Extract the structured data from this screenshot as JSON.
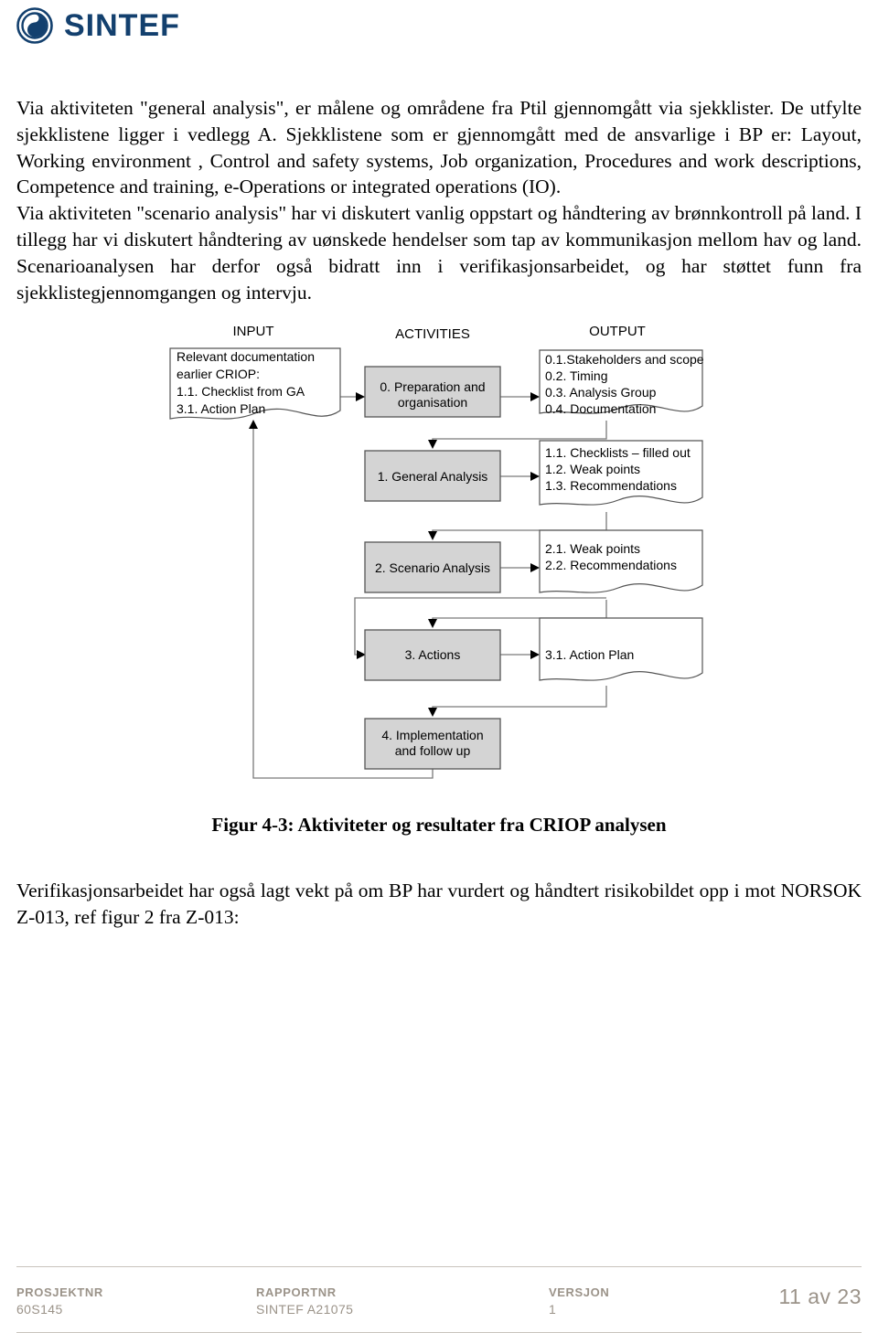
{
  "header": {
    "logo_text": "SINTEF",
    "logo_icon": "sintef-spiral-logo",
    "logo_color": "#13406e"
  },
  "body": {
    "paragraph_1": "Via aktiviteten \"general analysis\", er målene og områdene fra Ptil gjennomgått via sjekklister. De utfylte sjekklistene ligger i vedlegg A. Sjekklistene som er gjennomgått med de ansvarlige i BP er: Layout, Working environment , Control and safety systems, Job organization, Procedures and work descriptions, Competence and training, e-Operations or integrated operations (IO).",
    "paragraph_2": "Via aktiviteten \"scenario analysis\" har vi diskutert vanlig oppstart og håndtering av brønnkontroll på land. I tillegg har vi diskutert håndtering av uønskede hendelser som tap av kommunikasjon mellom hav og land. Scenarioanalysen har derfor også bidratt inn i verifikasjonsarbeidet, og har støttet funn fra sjekklistegjennomgangen og intervju.",
    "paragraph_3": "Verifikasjonsarbeidet har også lagt vekt på om BP har vurdert og håndtert risikobildet opp i mot NORSOK Z-013, ref figur 2 fra Z-013:"
  },
  "figure": {
    "caption": "Figur 4-3: Aktiviteter og resultater fra CRIOP analysen",
    "column_headers": {
      "input": "INPUT",
      "activities": "ACTIVITIES",
      "output": "OUTPUT"
    },
    "input_document": {
      "lines": [
        "Relevant documentation",
        "earlier CRIOP:",
        "1.1. Checklist from GA",
        "3.1. Action Plan"
      ]
    },
    "activities": [
      {
        "id": "activity-0",
        "label_line_1": "0. Preparation and",
        "label_line_2": "organisation"
      },
      {
        "id": "activity-1",
        "label_line_1": "1. General Analysis",
        "label_line_2": ""
      },
      {
        "id": "activity-2",
        "label_line_1": "2. Scenario Analysis",
        "label_line_2": ""
      },
      {
        "id": "activity-3",
        "label_line_1": "3. Actions",
        "label_line_2": ""
      },
      {
        "id": "activity-4",
        "label_line_1": "4. Implementation",
        "label_line_2": "and follow up"
      }
    ],
    "outputs": [
      {
        "id": "output-0",
        "lines": [
          "0.1.Stakeholders and scope",
          "0.2. Timing",
          "0.3. Analysis Group",
          "0.4. Documentation"
        ]
      },
      {
        "id": "output-1",
        "lines": [
          "1.1. Checklists – filled out",
          "1.2. Weak points",
          "1.3. Recommendations"
        ]
      },
      {
        "id": "output-2",
        "lines": [
          "2.1. Weak points",
          "2.2. Recommendations"
        ]
      },
      {
        "id": "output-3",
        "lines": [
          "3.1. Action Plan"
        ]
      }
    ],
    "box_fill": "#d4d4d4",
    "box_stroke": "#555555",
    "doc_stroke": "#555555",
    "line_color": "#7a7a7a"
  },
  "footer": {
    "columns": [
      {
        "label": "PROSJEKTNR",
        "value": "60S145"
      },
      {
        "label": "RAPPORTNR",
        "value": "SINTEF A21075"
      },
      {
        "label": "VERSJON",
        "value": "1"
      }
    ],
    "page": "11 av 23"
  }
}
